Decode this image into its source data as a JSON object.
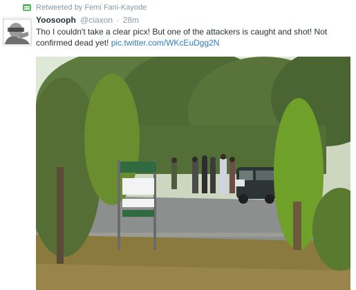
{
  "retweet": {
    "icon": "retweet-icon",
    "label": "Retweeted by Femi Fani-Kayode"
  },
  "tweet": {
    "avatar_icon": "avatar",
    "fullname": "Yoosooph",
    "username": "@ciaxon",
    "separator": "·",
    "time": "28m",
    "text": "Tho I couldn't take a clear picx! But one of the attackers is caught and shot! Not confirmed dead yet!",
    "link": "pic.twitter.com/WKcEuDgg2N"
  },
  "media": {
    "signboard_icon": "signboard",
    "colors": {
      "sky": "#dfe7d6",
      "foliage": "#4f6b35",
      "road": "#8c8f8e",
      "grass": "#8a7a3e"
    }
  }
}
